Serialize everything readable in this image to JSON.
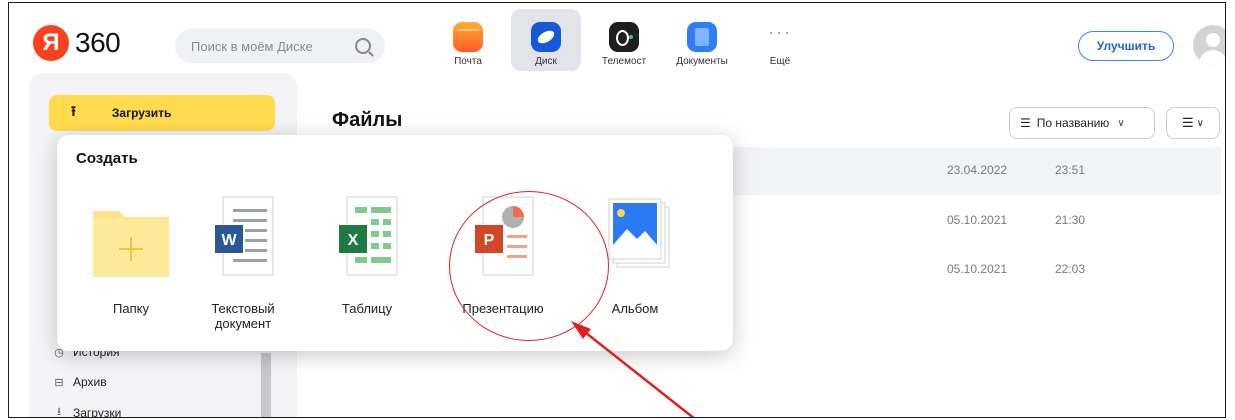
{
  "brand": {
    "logo_letter": "Я",
    "logo_text": "360",
    "color": "#fc3f1d"
  },
  "search": {
    "placeholder": "Поиск в моём Диске"
  },
  "apps": [
    {
      "label": "Почта",
      "icon": "mail-icon"
    },
    {
      "label": "Диск",
      "icon": "disk-icon",
      "active": true
    },
    {
      "label": "Телемост",
      "icon": "telemost-icon"
    },
    {
      "label": "Документы",
      "icon": "documents-icon"
    },
    {
      "label": "Ещё",
      "icon": "more-icon",
      "glyph": "···"
    }
  ],
  "header": {
    "upgrade_label": "Улучшить"
  },
  "sidebar": {
    "upload_label": "Загрузить",
    "items": [
      {
        "label": "История",
        "icon": "history-icon"
      },
      {
        "label": "Архив",
        "icon": "archive-icon"
      },
      {
        "label": "Загрузки",
        "icon": "downloads-icon"
      }
    ]
  },
  "main": {
    "title": "Файлы",
    "sort_label": "По названию",
    "rows": [
      {
        "date": "23.04.2022",
        "time": "23:51"
      },
      {
        "date": "05.10.2021",
        "time": "21:30"
      },
      {
        "date": "05.10.2021",
        "time": "22:03"
      }
    ]
  },
  "create_menu": {
    "title": "Создать",
    "items": [
      {
        "label": "Папку",
        "icon": "folder-icon"
      },
      {
        "label": "Текстовый документ",
        "icon": "word-document-icon",
        "letter": "W"
      },
      {
        "label": "Таблицу",
        "icon": "excel-spreadsheet-icon",
        "letter": "X"
      },
      {
        "label": "Презентацию",
        "icon": "powerpoint-presentation-icon",
        "letter": "P"
      },
      {
        "label": "Альбом",
        "icon": "album-icon"
      }
    ]
  },
  "colors": {
    "accent_yellow": "#ffdb4d",
    "annotation_red": "#e02020",
    "link_blue": "#2464d4"
  }
}
